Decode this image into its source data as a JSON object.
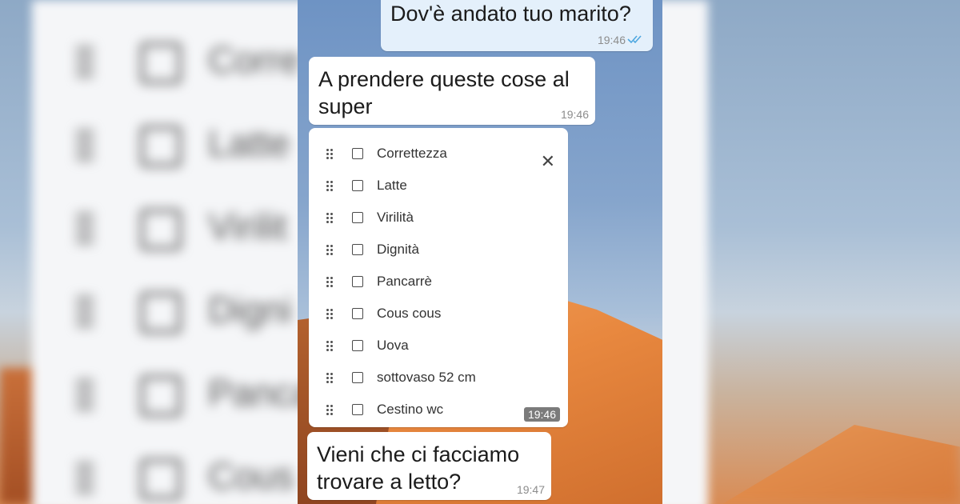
{
  "backdrop": {
    "labels": [
      "Corre",
      "Latte",
      "Virilit",
      "Digni",
      "Panca",
      "Cous"
    ]
  },
  "chat": {
    "messages": [
      {
        "direction": "outgoing",
        "text": "Dov'è andato tuo marito?",
        "time": "19:46",
        "status": "read"
      },
      {
        "direction": "incoming",
        "text": "A prendere queste cose al super",
        "time": "19:46"
      },
      {
        "direction": "incoming",
        "type": "checklist",
        "time": "19:46",
        "items": [
          "Correttezza",
          "Latte",
          "Virilità",
          "Dignità",
          "Pancarrè",
          "Cous cous",
          "Uova",
          "sottovaso 52 cm",
          "Cestino wc"
        ],
        "close_icon": "close-icon"
      },
      {
        "direction": "incoming",
        "text": "Vieni che ci facciamo trovare a letto?",
        "time": "19:47"
      }
    ]
  },
  "colors": {
    "outgoing_bubble": "#e4f0fb",
    "incoming_bubble": "#ffffff",
    "read_ticks": "#4fa8e0",
    "time_badge": "#7b7b7b"
  }
}
